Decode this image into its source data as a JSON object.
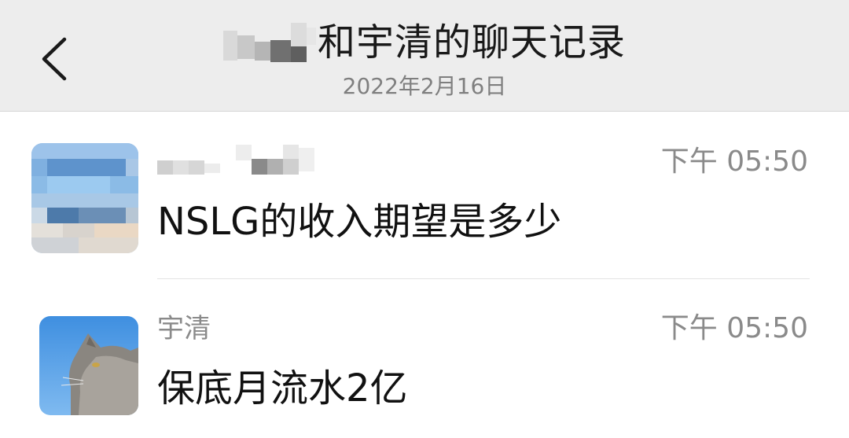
{
  "header": {
    "title": "和宇清的聊天记录",
    "subtitle": "2022年2月16日"
  },
  "messages": [
    {
      "sender": "",
      "time": "下午 05:50",
      "text": "NSLG的收入期望是多少"
    },
    {
      "sender": "宇清",
      "time": "下午 05:50",
      "text": "保底月流水2亿"
    }
  ],
  "icons": {
    "back": "chevron-left-icon"
  }
}
